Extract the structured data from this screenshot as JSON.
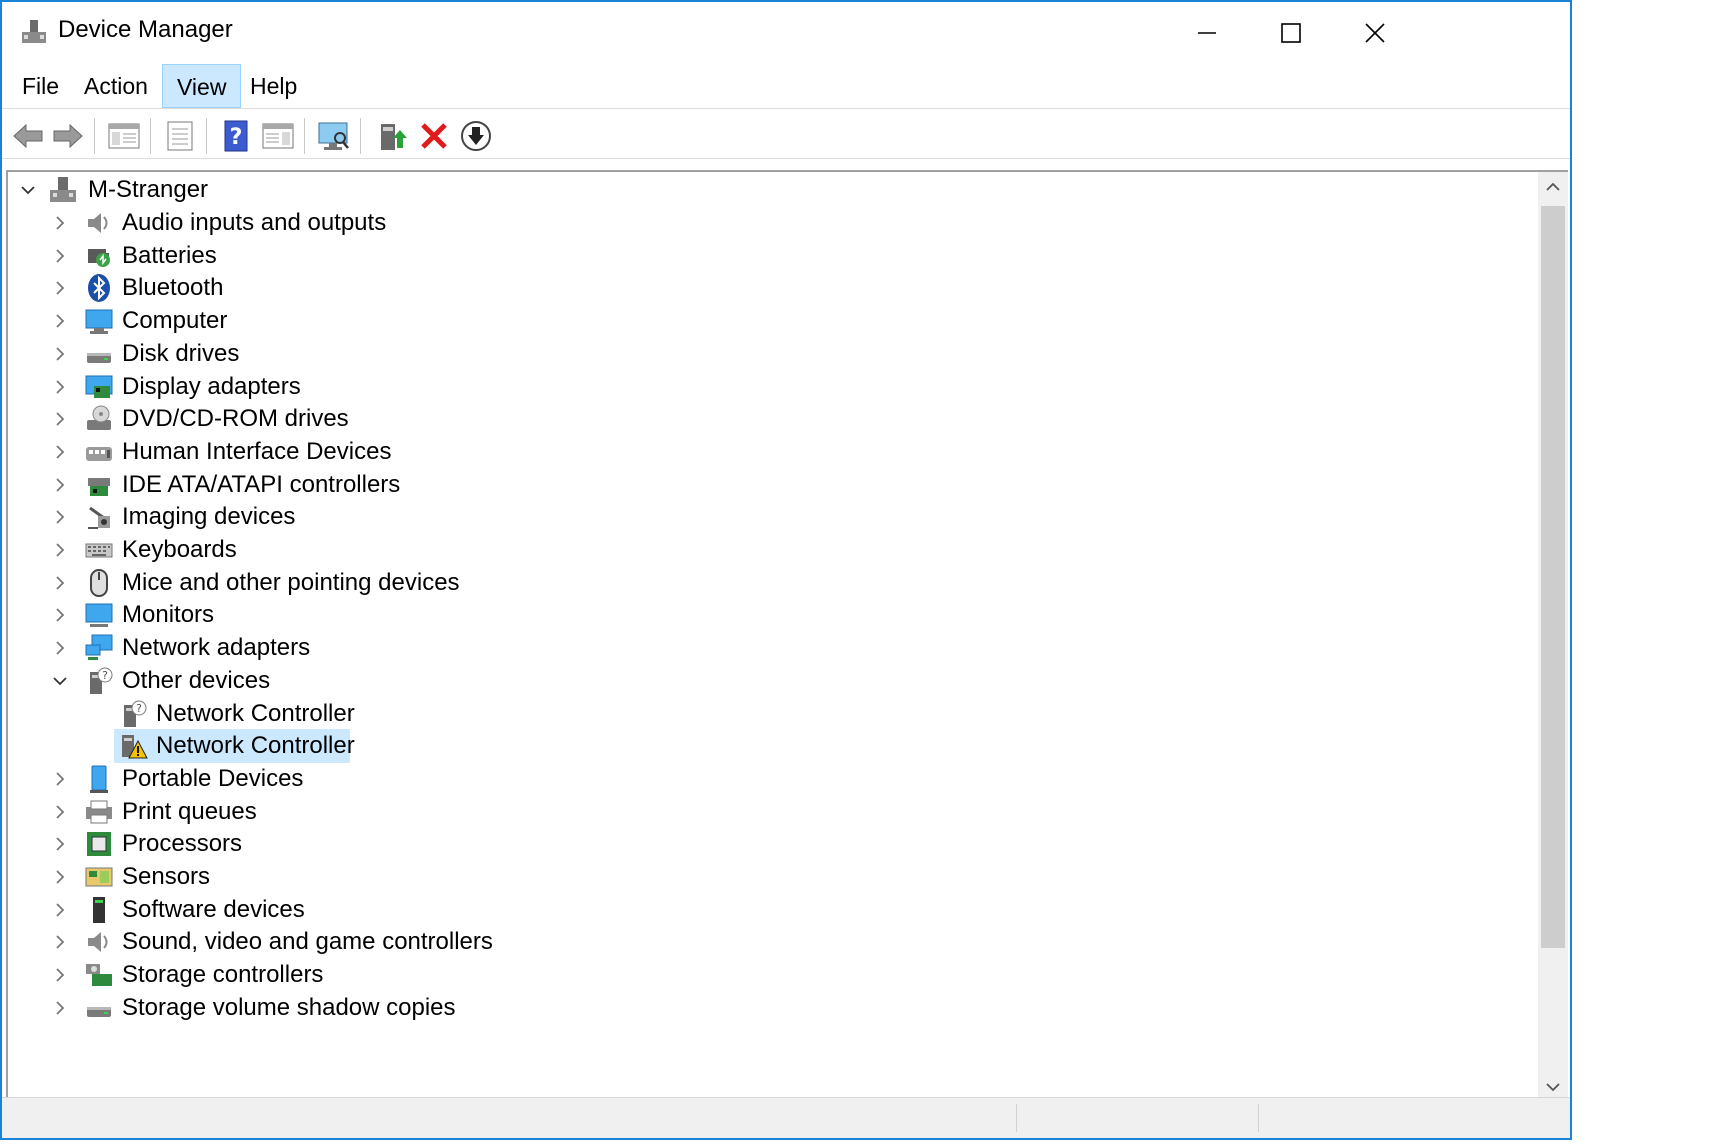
{
  "window": {
    "title": "Device Manager"
  },
  "menu": [
    {
      "label": "File"
    },
    {
      "label": "Action"
    },
    {
      "label": "View",
      "active": true
    },
    {
      "label": "Help"
    }
  ],
  "toolbar": [
    "back-arrow-icon",
    "forward-arrow-icon",
    "show-hide-console-tree-icon",
    "properties-icon",
    "help-icon",
    "action-pane-icon",
    "scan-hardware-changes-icon",
    "update-driver-icon",
    "uninstall-device-icon",
    "download-icon"
  ],
  "tree": {
    "root": "M-Stranger",
    "items": [
      {
        "label": "Audio inputs and outputs",
        "icon": "speaker-icon"
      },
      {
        "label": "Batteries",
        "icon": "battery-icon"
      },
      {
        "label": "Bluetooth",
        "icon": "bluetooth-icon"
      },
      {
        "label": "Computer",
        "icon": "computer-icon"
      },
      {
        "label": "Disk drives",
        "icon": "disk-drive-icon"
      },
      {
        "label": "Display adapters",
        "icon": "display-adapter-icon"
      },
      {
        "label": "DVD/CD-ROM drives",
        "icon": "dvd-drive-icon"
      },
      {
        "label": "Human Interface Devices",
        "icon": "hid-icon"
      },
      {
        "label": "IDE ATA/ATAPI controllers",
        "icon": "ide-controller-icon"
      },
      {
        "label": "Imaging devices",
        "icon": "camera-icon"
      },
      {
        "label": "Keyboards",
        "icon": "keyboard-icon"
      },
      {
        "label": "Mice and other pointing devices",
        "icon": "mouse-icon"
      },
      {
        "label": "Monitors",
        "icon": "monitor-icon"
      },
      {
        "label": "Network adapters",
        "icon": "network-adapter-icon"
      },
      {
        "label": "Other devices",
        "icon": "unknown-device-icon",
        "expanded": true,
        "children": [
          {
            "label": "Network Controller",
            "icon": "unknown-device-icon"
          },
          {
            "label": "Network Controller",
            "icon": "warning-device-icon",
            "selected": true
          }
        ]
      },
      {
        "label": "Portable Devices",
        "icon": "portable-device-icon"
      },
      {
        "label": "Print queues",
        "icon": "printer-icon"
      },
      {
        "label": "Processors",
        "icon": "processor-icon"
      },
      {
        "label": "Sensors",
        "icon": "sensor-icon"
      },
      {
        "label": "Software devices",
        "icon": "software-device-icon"
      },
      {
        "label": "Sound, video and game controllers",
        "icon": "speaker-icon"
      },
      {
        "label": "Storage controllers",
        "icon": "storage-controller-icon"
      },
      {
        "label": "Storage volume shadow copies",
        "icon": "disk-drive-icon"
      }
    ]
  },
  "colors": {
    "window_border": "#1883d7",
    "selection": "#cce8ff",
    "menu_active_border": "#99d1ff"
  }
}
